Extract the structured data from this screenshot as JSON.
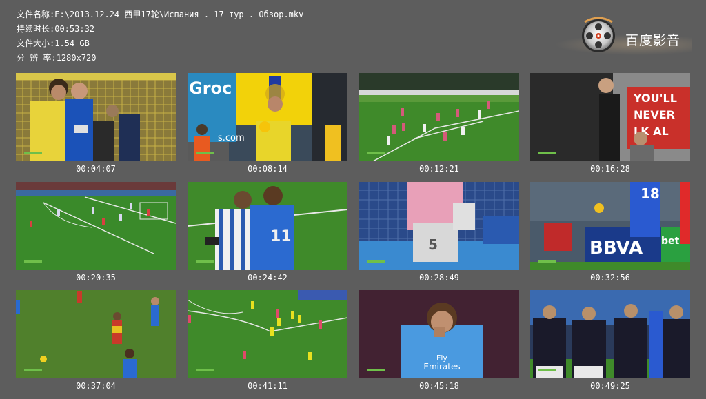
{
  "file_info": {
    "name_label": "文件名称:",
    "name_value": "E:\\2013.12.24 西甲17轮\\Испания . 17 тур . Обзор.mkv",
    "duration_label": "持续时长:",
    "duration_value": "00:53:32",
    "size_label": "文件大小:",
    "size_value": "1.54 GB",
    "resolution_label": "分 辨 率:",
    "resolution_value": "1280x720"
  },
  "logo": {
    "text": "百度影音",
    "icon": "film-reel-icon"
  },
  "thumb_text": {
    "t2": "Groc",
    "t2b": "s.com",
    "t4a": "YOU'LL",
    "t4b": "NEVER",
    "t4c": "LK AL",
    "t6": "11",
    "t7": "5",
    "t8a": "18",
    "t8b": "BBVA",
    "t8c": "bet",
    "t11": "Fly",
    "t11b": "Emirates"
  },
  "thumbnails": [
    {
      "timestamp": "00:04:07"
    },
    {
      "timestamp": "00:08:14"
    },
    {
      "timestamp": "00:12:21"
    },
    {
      "timestamp": "00:16:28"
    },
    {
      "timestamp": "00:20:35"
    },
    {
      "timestamp": "00:24:42"
    },
    {
      "timestamp": "00:28:49"
    },
    {
      "timestamp": "00:32:56"
    },
    {
      "timestamp": "00:37:04"
    },
    {
      "timestamp": "00:41:11"
    },
    {
      "timestamp": "00:45:18"
    },
    {
      "timestamp": "00:49:25"
    }
  ],
  "colors": {
    "background": "#5d5d5d",
    "text": "#ffffff",
    "pitch_green": "#3f8a2a"
  }
}
